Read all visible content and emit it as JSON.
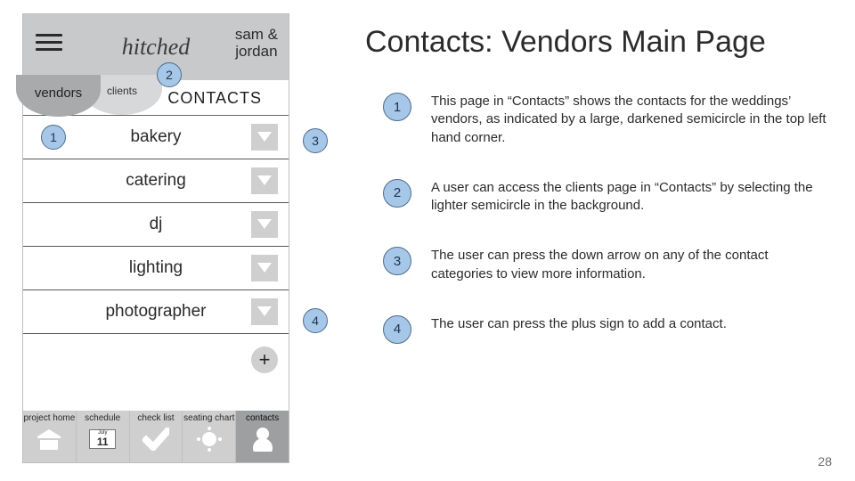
{
  "title": "Contacts: Vendors Main Page",
  "page_number": "28",
  "phone": {
    "brand": "hitched",
    "couple_line1": "sam &",
    "couple_line2": "jordan",
    "tab_vendors": "vendors",
    "tab_clients": "clients",
    "section_title": "CONTACTS",
    "contacts": [
      {
        "label": "bakery"
      },
      {
        "label": "catering"
      },
      {
        "label": "dj"
      },
      {
        "label": "lighting"
      },
      {
        "label": "photographer"
      }
    ],
    "tabbar": [
      {
        "label": "project home"
      },
      {
        "label": "schedule",
        "month": "July",
        "day": "11"
      },
      {
        "label": "check list"
      },
      {
        "label": "seating chart"
      },
      {
        "label": "contacts"
      }
    ]
  },
  "explain": [
    {
      "num": "1",
      "text": "This page in “Contacts” shows the contacts for the weddings’ vendors, as indicated by a large, darkened semicircle in the top left hand corner."
    },
    {
      "num": "2",
      "text": "A user can access the clients page in “Contacts” by selecting the lighter semicircle in the background."
    },
    {
      "num": "3",
      "text": "The user can press the down arrow on any of the contact categories to view more information."
    },
    {
      "num": "4",
      "text": "The user can press the plus sign to add a contact."
    }
  ],
  "markers": [
    {
      "num": "1"
    },
    {
      "num": "2"
    },
    {
      "num": "3"
    },
    {
      "num": "4"
    }
  ]
}
